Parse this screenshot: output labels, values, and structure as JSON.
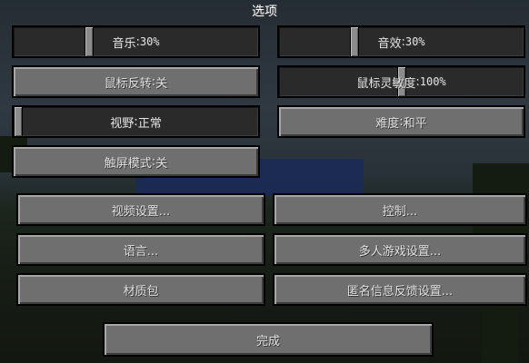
{
  "screen": {
    "title": "选项"
  },
  "sliders": {
    "music": {
      "label": "音乐",
      "value": "30%",
      "level": 0.3
    },
    "sound": {
      "label": "音效",
      "value": "30%",
      "level": 0.3
    },
    "sensitivity": {
      "label": "鼠标灵敏度",
      "value": "100%",
      "level": 0.5
    },
    "fov": {
      "label": "视野",
      "value": "正常",
      "level": 0.0
    }
  },
  "options": {
    "invert_mouse": {
      "label": "鼠标反转",
      "value": "关"
    },
    "difficulty": {
      "label": "难度",
      "value": "和平"
    },
    "touchscreen": {
      "label": "触屏模式",
      "value": "关"
    }
  },
  "menu": {
    "video": "视频设置...",
    "controls": "控制...",
    "language": "语言...",
    "multiplayer": "多人游戏设置...",
    "resource_packs": "材质包",
    "snooper": "匿名信息反馈设置...",
    "done": "完成"
  },
  "label_separator": ": "
}
